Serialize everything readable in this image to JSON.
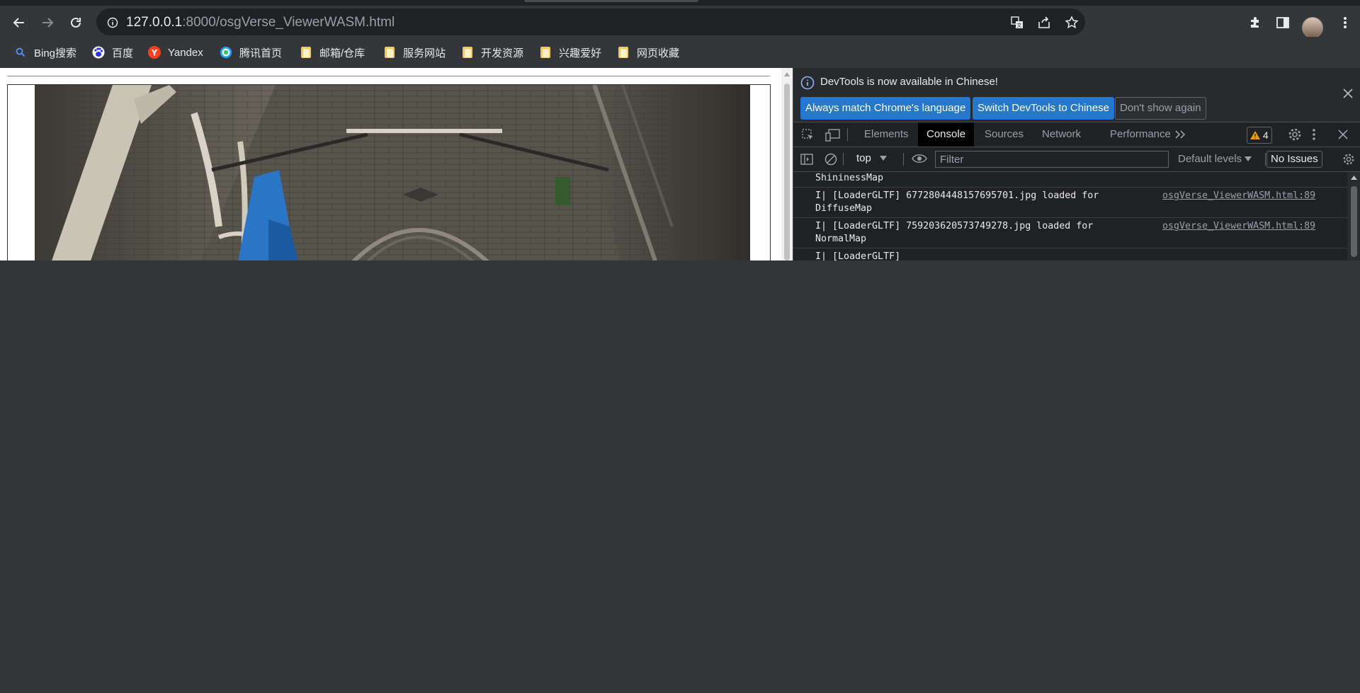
{
  "browser": {
    "url_host": "127.0.0.1",
    "url_rest": ":8000/osgVerse_ViewerWASM.html",
    "icons": {
      "back": "back-arrow-icon",
      "forward": "forward-arrow-icon",
      "reload": "reload-icon",
      "site_info": "info-icon",
      "translate": "translate-icon",
      "share": "share-icon",
      "bookmark": "star-icon",
      "extensions": "puzzle-icon",
      "side_panel": "side-panel-icon",
      "profile": "avatar"
    }
  },
  "bookmarks": [
    {
      "label": "Bing搜索",
      "icon": "search-icon"
    },
    {
      "label": "百度",
      "icon": "baidu-icon"
    },
    {
      "label": "Yandex",
      "icon": "yandex-icon"
    },
    {
      "label": "腾讯首页",
      "icon": "tencent-icon"
    },
    {
      "label": "邮箱/仓库",
      "icon": "folder-icon"
    },
    {
      "label": "服务网站",
      "icon": "folder-icon"
    },
    {
      "label": "开发资源",
      "icon": "folder-icon"
    },
    {
      "label": "兴趣爱好",
      "icon": "folder-icon"
    },
    {
      "label": "网页收藏",
      "icon": "folder-icon"
    }
  ],
  "devtools": {
    "notice": "DevTools is now available in Chinese!",
    "btn_match": "Always match Chrome's language",
    "btn_switch": "Switch DevTools to Chinese",
    "btn_dismiss": "Don't show again",
    "tabs": [
      "Elements",
      "Console",
      "Sources",
      "Network",
      "Performance"
    ],
    "active_tab": "Console",
    "warnings_count": "4",
    "context": "top",
    "filter_placeholder": "Filter",
    "levels": "Default levels",
    "issues": "No Issues",
    "console": [
      {
        "msg": "ShininessMap",
        "src": ""
      },
      {
        "msg": "I| [LoaderGLTF] 6772804448157695701.jpg loaded for\nDiffuseMap",
        "src": "osgVerse_ViewerWASM.html:89"
      },
      {
        "msg": "I| [LoaderGLTF] 759203620573749278.jpg loaded for\nNormalMap",
        "src": "osgVerse_ViewerWASM.html:89"
      },
      {
        "msg": "I| [LoaderGLTF]",
        "src": ""
      }
    ]
  },
  "colors": {
    "chrome_bg": "#35363a",
    "devtools_bg": "#202124",
    "accent_blue": "#2679c8",
    "warning": "#f29900"
  }
}
